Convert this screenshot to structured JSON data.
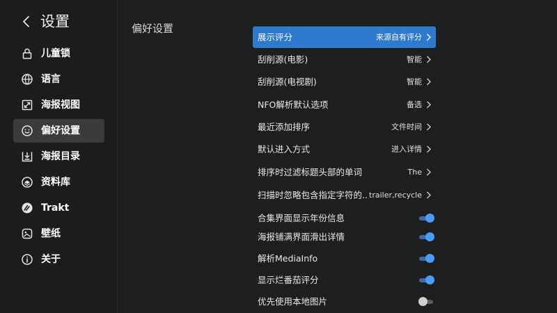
{
  "sidebar": {
    "title": "设置",
    "back_icon": "back-arrow-icon",
    "items": [
      {
        "label": "儿童锁",
        "icon": "lock-icon",
        "active": false
      },
      {
        "label": "语言",
        "icon": "globe-icon",
        "active": false
      },
      {
        "label": "海报视图",
        "icon": "expand-icon",
        "active": false
      },
      {
        "label": "偏好设置",
        "icon": "smiley-icon",
        "active": true
      },
      {
        "label": "海报目录",
        "icon": "download-box-icon",
        "active": false
      },
      {
        "label": "资料库",
        "icon": "library-icon",
        "active": false
      },
      {
        "label": "Trakt",
        "icon": "trakt-icon",
        "active": false
      },
      {
        "label": "壁纸",
        "icon": "wallpaper-icon",
        "active": false
      },
      {
        "label": "关于",
        "icon": "info-icon",
        "active": false
      }
    ]
  },
  "main": {
    "section_title": "偏好设置",
    "rows": [
      {
        "label": "展示评分",
        "value": "来源自有评分",
        "type": "select",
        "selected": true
      },
      {
        "label": "刮削源(电影)",
        "value": "智能",
        "type": "select"
      },
      {
        "label": "刮削源(电视剧)",
        "value": "智能",
        "type": "select"
      },
      {
        "label": "NFO解析默认选项",
        "value": "备选",
        "type": "select"
      },
      {
        "label": "最近添加排序",
        "value": "文件时间",
        "type": "select"
      },
      {
        "label": "默认进入方式",
        "value": "进入详情",
        "type": "select"
      },
      {
        "label": "排序时过滤标题头部的单词",
        "value": "The",
        "type": "select"
      },
      {
        "label": "扫描时忽略包含指定字符的..",
        "value": "trailer,recycle",
        "type": "select"
      },
      {
        "label": "合集界面显示年份信息",
        "on": true,
        "type": "toggle"
      },
      {
        "label": "海报铺满界面滑出详情",
        "on": true,
        "type": "toggle"
      },
      {
        "label": "解析MediaInfo",
        "on": true,
        "type": "toggle"
      },
      {
        "label": "显示烂番茄评分",
        "on": true,
        "type": "toggle"
      },
      {
        "label": "优先使用本地图片",
        "on": false,
        "type": "toggle"
      }
    ]
  },
  "colors": {
    "background": "#1d1e20",
    "accent": "#2f7ad1",
    "toggle_on": "#4a9cf4",
    "toggle_off": "#d0d0d0",
    "active_nav": "#3a3b3d"
  }
}
